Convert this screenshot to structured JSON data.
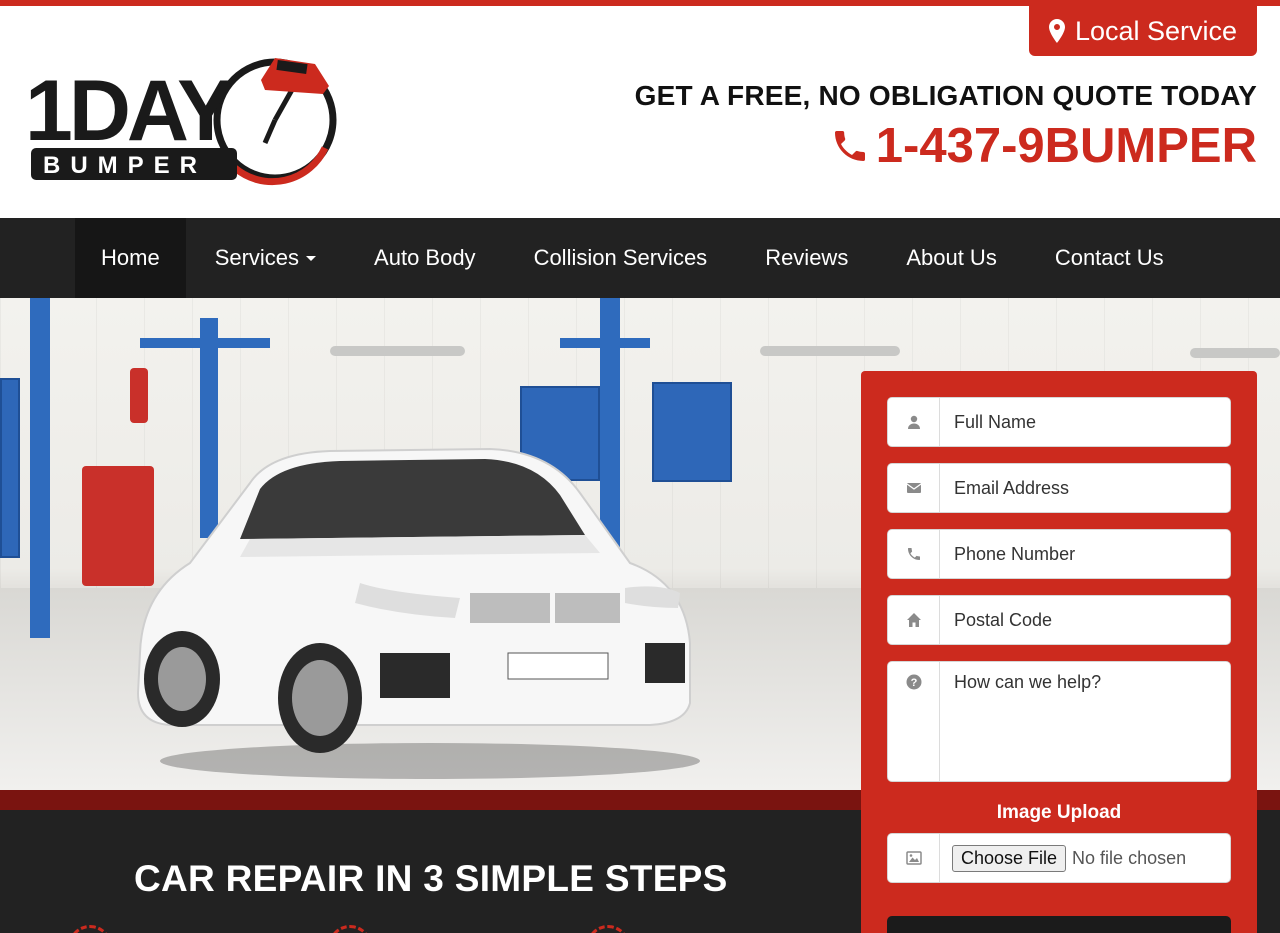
{
  "header": {
    "local_service": "Local Service",
    "quote_text": "GET A FREE, NO OBLIGATION QUOTE TODAY",
    "phone": "1-437-9BUMPER",
    "logo": {
      "word1": "1DAY",
      "word2": "BUMPER"
    }
  },
  "nav": {
    "items": [
      {
        "label": "Home",
        "active": true
      },
      {
        "label": "Services",
        "dropdown": true
      },
      {
        "label": "Auto Body"
      },
      {
        "label": "Collision Services"
      },
      {
        "label": "Reviews"
      },
      {
        "label": "About Us"
      },
      {
        "label": "Contact Us"
      }
    ]
  },
  "form": {
    "full_name_placeholder": "Full Name",
    "email_placeholder": "Email Address",
    "phone_placeholder": "Phone Number",
    "postal_placeholder": "Postal Code",
    "message_placeholder": "How can we help?",
    "upload_label": "Image Upload",
    "choose_file": "Choose File",
    "no_file": "No file chosen"
  },
  "steps": {
    "title": "CAR REPAIR IN 3 SIMPLE STEPS"
  },
  "colors": {
    "brand_red": "#cc2a1e",
    "dark": "#222222",
    "dark_red": "#7a1410"
  }
}
